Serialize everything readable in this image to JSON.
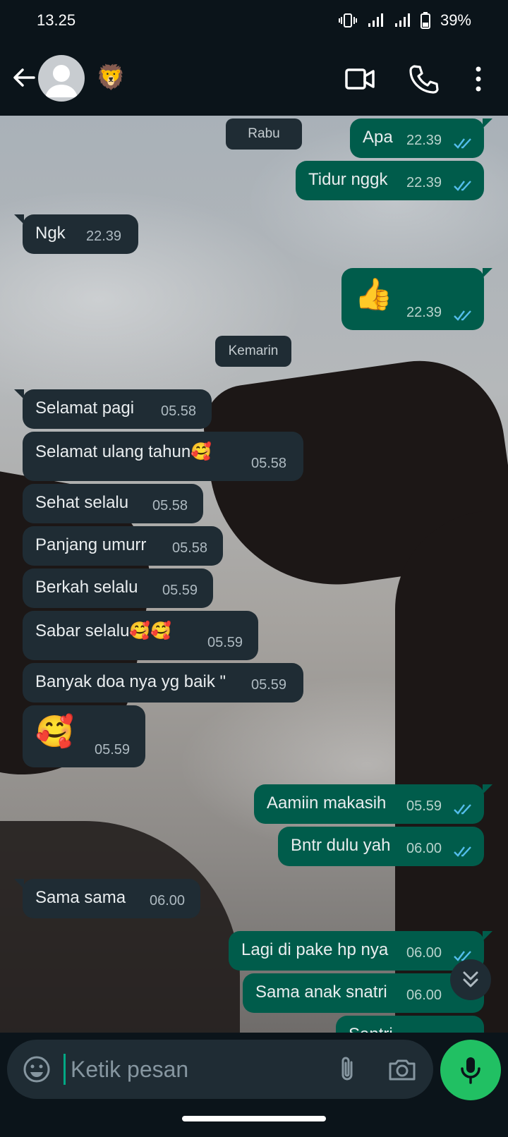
{
  "status_bar": {
    "time": "13.25",
    "battery": "39%"
  },
  "header": {
    "contact_name": "🦁",
    "icons": [
      "back-arrow-icon",
      "avatar",
      "video-call-icon",
      "phone-call-icon",
      "more-options-icon"
    ]
  },
  "chat": {
    "dates": [
      "Rabu",
      "Kemarin"
    ],
    "messages": [
      {
        "dir": "out",
        "text": "Apa",
        "time": "22.39"
      },
      {
        "dir": "out",
        "text": "Tidur nggk",
        "time": "22.39"
      },
      {
        "dir": "in",
        "text": "Ngk",
        "time": "22.39"
      },
      {
        "dir": "out",
        "text": "👍",
        "time": "22.39"
      },
      {
        "dir": "in",
        "text": "Selamat pagi",
        "time": "05.58"
      },
      {
        "dir": "in",
        "text": "Selamat ulang tahun🥰",
        "time": "05.58"
      },
      {
        "dir": "in",
        "text": "Sehat selalu",
        "time": "05.58"
      },
      {
        "dir": "in",
        "text": "Panjang umurr",
        "time": "05.58"
      },
      {
        "dir": "in",
        "text": "Berkah selalu",
        "time": "05.59"
      },
      {
        "dir": "in",
        "text": "Sabar selalu🥰🥰",
        "time": "05.59"
      },
      {
        "dir": "in",
        "text": "Banyak doa nya yg baik \"",
        "time": "05.59"
      },
      {
        "dir": "in",
        "text": "🥰",
        "time": "05.59"
      },
      {
        "dir": "out",
        "text": "Aamiin makasih",
        "time": "05.59"
      },
      {
        "dir": "out",
        "text": "Bntr dulu yah",
        "time": "06.00"
      },
      {
        "dir": "in",
        "text": "Sama sama",
        "time": "06.00"
      },
      {
        "dir": "out",
        "text": "Lagi di pake hp nya",
        "time": "06.00"
      },
      {
        "dir": "out",
        "text": "Sama anak snatri",
        "time": "06.00"
      },
      {
        "dir": "out",
        "text": "Santri",
        "time": ""
      }
    ]
  },
  "input": {
    "placeholder": "Ketik pesan"
  },
  "colors": {
    "incoming_bubble": "#1f2c34",
    "outgoing_bubble": "#005c4b",
    "accent": "#21c063",
    "read_tick": "#53bdeb"
  }
}
